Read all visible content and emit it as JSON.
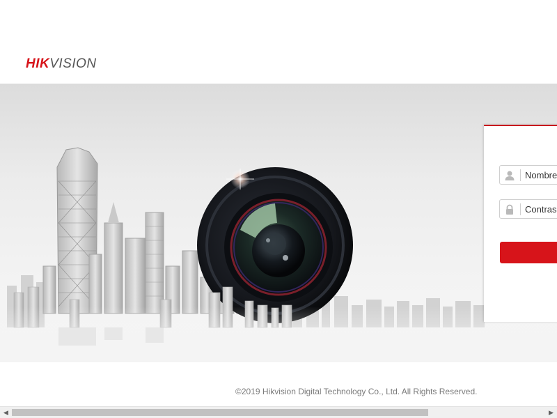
{
  "header": {
    "logo_part1": "HIK",
    "logo_part2": "VISION"
  },
  "login": {
    "username_placeholder": "Nombre de usuario",
    "password_placeholder": "Contraseña",
    "button_label": ""
  },
  "footer": {
    "copyright": "©2019 Hikvision Digital Technology Co., Ltd. All Rights Reserved."
  },
  "colors": {
    "brand_red": "#d7141a",
    "panel_border": "#c8161d",
    "copyright_text": "#7a7a7a"
  },
  "icons": {
    "username": "user-icon",
    "password": "lock-icon",
    "scroll_left": "arrow-left-icon",
    "scroll_right": "arrow-right-icon"
  }
}
